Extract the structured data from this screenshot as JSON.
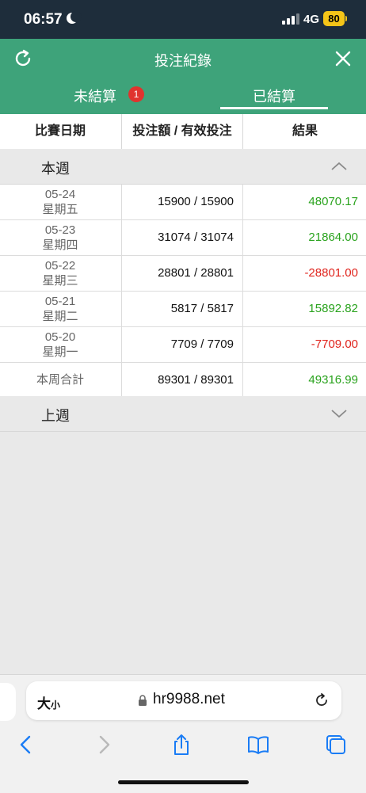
{
  "status": {
    "time": "06:57",
    "network": "4G",
    "battery": "80"
  },
  "header": {
    "title": "投注紀錄"
  },
  "tabs": [
    {
      "label": "未結算",
      "badge": "1"
    },
    {
      "label": "已結算"
    }
  ],
  "columns": [
    "比賽日期",
    "投注額 / 有效投注",
    "結果"
  ],
  "groups": {
    "this_week": "本週",
    "last_week": "上週"
  },
  "rows": [
    {
      "date": "05-24",
      "weekday": "星期五",
      "amount": "15900 / 15900",
      "result": "48070.17"
    },
    {
      "date": "05-23",
      "weekday": "星期四",
      "amount": "31074 / 31074",
      "result": "21864.00"
    },
    {
      "date": "05-22",
      "weekday": "星期三",
      "amount": "28801 / 28801",
      "result": "-28801.00"
    },
    {
      "date": "05-21",
      "weekday": "星期二",
      "amount": "5817 / 5817",
      "result": "15892.82"
    },
    {
      "date": "05-20",
      "weekday": "星期一",
      "amount": "7709 / 7709",
      "result": "-7709.00"
    }
  ],
  "total": {
    "label": "本周合計",
    "amount": "89301 / 89301",
    "result": "49316.99"
  },
  "browser": {
    "text_size_big": "大",
    "text_size_small": "小",
    "url": "hr9988.net"
  },
  "colors": {
    "header_green": "#3ea37a",
    "positive": "#2aa31e",
    "negative": "#e0241d",
    "status_bar": "#1e2d3b"
  }
}
